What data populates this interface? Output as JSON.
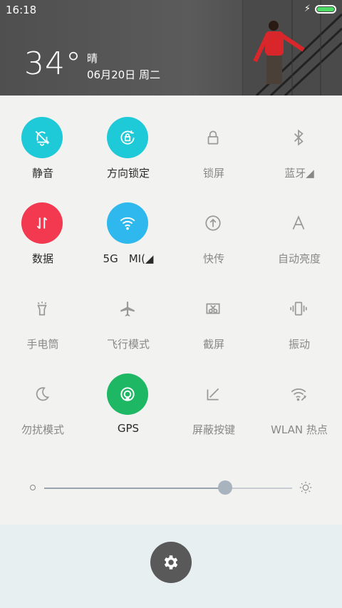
{
  "status_bar": {
    "time": "16:18",
    "charging_icon": "lightning-bolt-icon",
    "battery_level": 1.0,
    "battery_color": "#4cd964"
  },
  "weather": {
    "temperature": "34°",
    "condition": "晴",
    "date": "06月20日 周二"
  },
  "toggles": [
    {
      "label": "静音",
      "icon": "bell-off-icon",
      "active": true,
      "color": "#1ec9d8"
    },
    {
      "label": "方向锁定",
      "icon": "rotation-lock-icon",
      "active": true,
      "color": "#1ec9d8"
    },
    {
      "label": "锁屏",
      "icon": "lock-icon",
      "active": false
    },
    {
      "label": "蓝牙◢",
      "icon": "bluetooth-icon",
      "active": false
    },
    {
      "label": "数据",
      "icon": "data-arrows-icon",
      "active": true,
      "color": "#f2394f"
    },
    {
      "label": "5G　MI(◢",
      "icon": "wifi-icon",
      "active": true,
      "color": "#2fb8ee"
    },
    {
      "label": "快传",
      "icon": "upload-circle-icon",
      "active": false
    },
    {
      "label": "自动亮度",
      "icon": "auto-brightness-icon",
      "active": false
    },
    {
      "label": "手电筒",
      "icon": "flashlight-icon",
      "active": false
    },
    {
      "label": "飞行模式",
      "icon": "airplane-icon",
      "active": false
    },
    {
      "label": "截屏",
      "icon": "screenshot-icon",
      "active": false
    },
    {
      "label": "振动",
      "icon": "vibrate-icon",
      "active": false
    },
    {
      "label": "勿扰模式",
      "icon": "moon-icon",
      "active": false
    },
    {
      "label": "GPS",
      "icon": "location-icon",
      "active": true,
      "color": "#1eb865"
    },
    {
      "label": "屏蔽按键",
      "icon": "block-keys-icon",
      "active": false
    },
    {
      "label": "WLAN 热点",
      "icon": "hotspot-icon",
      "active": false
    }
  ],
  "brightness": {
    "level": 0.73
  },
  "footer": {
    "settings_icon": "gear-icon"
  }
}
